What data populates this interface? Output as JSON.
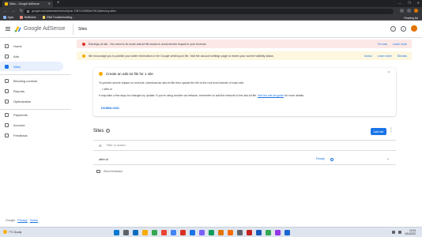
{
  "browser": {
    "tab_title": "Sites – Google AdSense",
    "url": "google.com/adsense/new/u/0/pub-7087123983647814/sites/my-sites",
    "bookmarks": [
      {
        "label": "Apps",
        "color": "#8ab4f8"
      },
      {
        "label": "NetBrains",
        "color": "#f28b82"
      },
      {
        "label": "DBA Troubleshooting...",
        "color": "#fdd663"
      }
    ],
    "bookmarks_right": "Reading list",
    "new_tab": "+",
    "window_controls": [
      "—",
      "❐",
      "✕"
    ]
  },
  "header": {
    "brand": "Google AdSense",
    "page_title": "Sites",
    "icons": [
      "help-icon",
      "notifications-icon",
      "account-avatar"
    ]
  },
  "sidebar": {
    "items": [
      {
        "label": "Home",
        "icon": "home-icon",
        "active": false
      },
      {
        "label": "Ads",
        "icon": "ads-icon",
        "active": false
      },
      {
        "label": "Sites",
        "icon": "sites-icon",
        "active": true
      },
      {
        "label": "Blocking controls",
        "icon": "block-icon",
        "active": false
      },
      {
        "label": "Reports",
        "icon": "reports-icon",
        "active": false
      },
      {
        "label": "Optimization",
        "icon": "optimization-icon",
        "active": false
      },
      {
        "label": "Payments",
        "icon": "payments-icon",
        "active": false
      },
      {
        "label": "Account",
        "icon": "account-icon",
        "active": false
      },
      {
        "label": "Feedback",
        "icon": "feedback-icon",
        "active": false
      }
    ],
    "footer": {
      "google": "Google",
      "privacy": "Privacy",
      "terms": "Terms"
    }
  },
  "banners": {
    "earnings": {
      "text": "Earnings at risk - You need to fix some ads.txt file issues to avoid severe impact to your revenue.",
      "actions": [
        "Fix now",
        "Learn more"
      ],
      "color": "#fce8e6"
    },
    "sellers": {
      "text": "We encourage you to publish your seller information in the Google sellers.json file. Visit the account settings page to review your current visibility status.",
      "actions": [
        "Action",
        "Learn more",
        "Dismiss"
      ],
      "color": "#fef7e0"
    }
  },
  "adstxt_card": {
    "title": "Create an ads.txt file for 1 site",
    "line1": "To prevent severe impact on revenue, download an ads.txt file then upload the file to the root level domain of each site:",
    "site": "• offer.nl",
    "line3": "It may take a few days for changes by update. If you're using another ad network, remember to add the network to the ads.txt file.",
    "line3_link": "See the ads.txt guide",
    "line3_suffix": "for more details.",
    "download": "DOWNLOAD",
    "collapse_icon": "^"
  },
  "sites": {
    "title": "Sites",
    "add_site": "Add site",
    "filter_placeholder": "Filter or search...",
    "rows": [
      {
        "name": "offer.nl",
        "status": "Ready"
      }
    ],
    "feedback": "Send feedback"
  },
  "taskbar": {
    "weather": "7°C Cloudy",
    "time": "12:04",
    "date": "4/11/2022",
    "app_colors": [
      "#0078d4",
      "#5f6368",
      "#0f6cbd",
      "#f9ab00",
      "#34a853",
      "#ea4335",
      "#4285f4",
      "#d93025",
      "#1a73e8",
      "#7b61ff",
      "#0f9d58",
      "#e37400",
      "#ff6d00",
      "#5f6368",
      "#c5221f",
      "#185abc",
      "#34a853",
      "#9334e6",
      "#1967d2"
    ]
  },
  "colors": {
    "accent": "#1a73e8",
    "active_nav_bg": "#e8f0fe",
    "warning": "#f9ab00",
    "error": "#d93025"
  }
}
